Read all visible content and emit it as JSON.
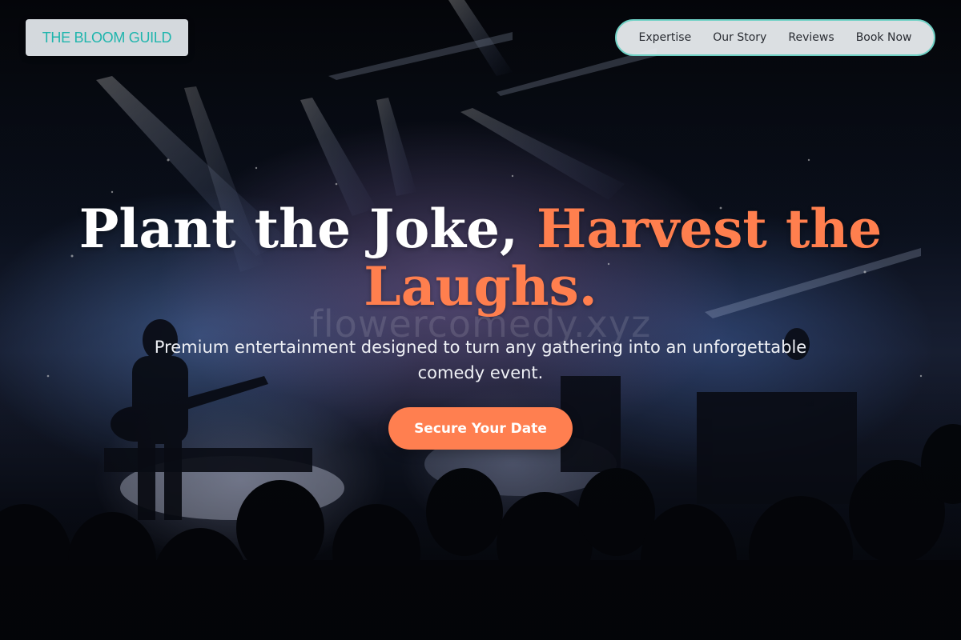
{
  "brand": {
    "logo_text": "THE BLOOM GUILD"
  },
  "nav": {
    "items": [
      {
        "label": "Expertise"
      },
      {
        "label": "Our Story"
      },
      {
        "label": "Reviews"
      },
      {
        "label": "Book Now"
      }
    ]
  },
  "hero": {
    "headline_part1": "Plant the Joke, ",
    "headline_accent": "Harvest the Laughs.",
    "watermark": "flowercomedy.xyz",
    "subtitle": "Premium entertainment designed to turn any gathering into an unforgettable comedy event.",
    "cta_label": "Secure Your Date",
    "background_image": "concert-stage-crowd"
  },
  "colors": {
    "accent": "#ff7f50",
    "logo_text": "#1fb5ad",
    "nav_border": "#6fd1c5"
  }
}
